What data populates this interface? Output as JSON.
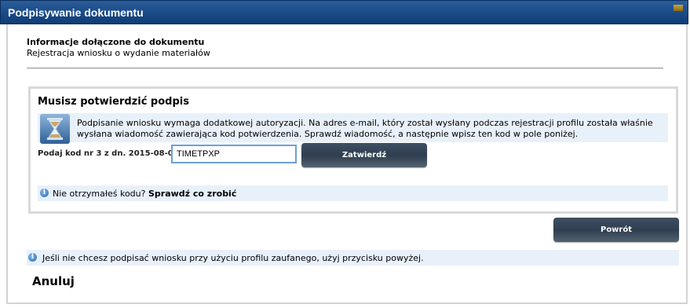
{
  "window": {
    "title": "Podpisywanie dokumentu"
  },
  "document_info": {
    "heading": "Informacje dołączone do dokumentu",
    "description": "Rejestracja wniosku o wydanie materiałów"
  },
  "confirm_panel": {
    "title": "Musisz potwierdzić podpis",
    "auth_message": "Podpisanie wniosku wymaga dodatkowej autoryzacji. Na adres e-mail, który został wysłany podczas rejestracji profilu została właśnie wysłana wiadomość zawierająca kod potwierdzenia. Sprawdź wiadomość, a następnie wpisz ten kod w pole poniżej.",
    "code_label": "Podaj kod nr 3 z dn. 2015-08-04:",
    "code_value": "TIMETPXP",
    "confirm_button": "Zatwierdź",
    "no_code_text": "Nie otrzymałeś kodu?",
    "no_code_link": "Sprawdź co zrobić"
  },
  "back_button": "Powrót",
  "footer_note": "Jeśli nie chcesz podpisać wniosku przy użyciu profilu zaufanego, użyj przycisku powyżej.",
  "cancel_link": "Anuluj",
  "icons": {
    "auth": "hourglass-icon",
    "info": "info-icon"
  },
  "colors": {
    "titlebar": "#0e3c76",
    "info_box": "#e8f1fa",
    "button": "#2f3e50",
    "input_border": "#6f9fd6"
  }
}
